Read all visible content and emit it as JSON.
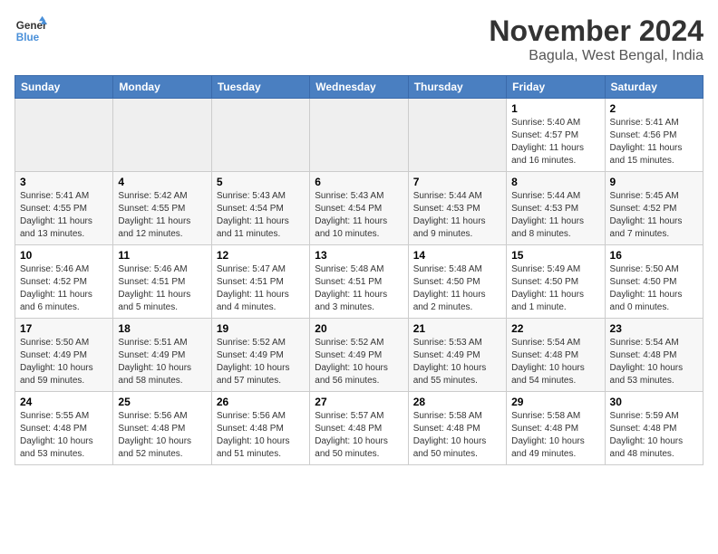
{
  "header": {
    "logo": {
      "line1": "General",
      "line2": "Blue"
    },
    "title": "November 2024",
    "location": "Bagula, West Bengal, India"
  },
  "columns": [
    "Sunday",
    "Monday",
    "Tuesday",
    "Wednesday",
    "Thursday",
    "Friday",
    "Saturday"
  ],
  "weeks": [
    [
      {
        "day": "",
        "info": "",
        "empty": true
      },
      {
        "day": "",
        "info": "",
        "empty": true
      },
      {
        "day": "",
        "info": "",
        "empty": true
      },
      {
        "day": "",
        "info": "",
        "empty": true
      },
      {
        "day": "",
        "info": "",
        "empty": true
      },
      {
        "day": "1",
        "info": "Sunrise: 5:40 AM\nSunset: 4:57 PM\nDaylight: 11 hours and 16 minutes."
      },
      {
        "day": "2",
        "info": "Sunrise: 5:41 AM\nSunset: 4:56 PM\nDaylight: 11 hours and 15 minutes."
      }
    ],
    [
      {
        "day": "3",
        "info": "Sunrise: 5:41 AM\nSunset: 4:55 PM\nDaylight: 11 hours and 13 minutes."
      },
      {
        "day": "4",
        "info": "Sunrise: 5:42 AM\nSunset: 4:55 PM\nDaylight: 11 hours and 12 minutes."
      },
      {
        "day": "5",
        "info": "Sunrise: 5:43 AM\nSunset: 4:54 PM\nDaylight: 11 hours and 11 minutes."
      },
      {
        "day": "6",
        "info": "Sunrise: 5:43 AM\nSunset: 4:54 PM\nDaylight: 11 hours and 10 minutes."
      },
      {
        "day": "7",
        "info": "Sunrise: 5:44 AM\nSunset: 4:53 PM\nDaylight: 11 hours and 9 minutes."
      },
      {
        "day": "8",
        "info": "Sunrise: 5:44 AM\nSunset: 4:53 PM\nDaylight: 11 hours and 8 minutes."
      },
      {
        "day": "9",
        "info": "Sunrise: 5:45 AM\nSunset: 4:52 PM\nDaylight: 11 hours and 7 minutes."
      }
    ],
    [
      {
        "day": "10",
        "info": "Sunrise: 5:46 AM\nSunset: 4:52 PM\nDaylight: 11 hours and 6 minutes."
      },
      {
        "day": "11",
        "info": "Sunrise: 5:46 AM\nSunset: 4:51 PM\nDaylight: 11 hours and 5 minutes."
      },
      {
        "day": "12",
        "info": "Sunrise: 5:47 AM\nSunset: 4:51 PM\nDaylight: 11 hours and 4 minutes."
      },
      {
        "day": "13",
        "info": "Sunrise: 5:48 AM\nSunset: 4:51 PM\nDaylight: 11 hours and 3 minutes."
      },
      {
        "day": "14",
        "info": "Sunrise: 5:48 AM\nSunset: 4:50 PM\nDaylight: 11 hours and 2 minutes."
      },
      {
        "day": "15",
        "info": "Sunrise: 5:49 AM\nSunset: 4:50 PM\nDaylight: 11 hours and 1 minute."
      },
      {
        "day": "16",
        "info": "Sunrise: 5:50 AM\nSunset: 4:50 PM\nDaylight: 11 hours and 0 minutes."
      }
    ],
    [
      {
        "day": "17",
        "info": "Sunrise: 5:50 AM\nSunset: 4:49 PM\nDaylight: 10 hours and 59 minutes."
      },
      {
        "day": "18",
        "info": "Sunrise: 5:51 AM\nSunset: 4:49 PM\nDaylight: 10 hours and 58 minutes."
      },
      {
        "day": "19",
        "info": "Sunrise: 5:52 AM\nSunset: 4:49 PM\nDaylight: 10 hours and 57 minutes."
      },
      {
        "day": "20",
        "info": "Sunrise: 5:52 AM\nSunset: 4:49 PM\nDaylight: 10 hours and 56 minutes."
      },
      {
        "day": "21",
        "info": "Sunrise: 5:53 AM\nSunset: 4:49 PM\nDaylight: 10 hours and 55 minutes."
      },
      {
        "day": "22",
        "info": "Sunrise: 5:54 AM\nSunset: 4:48 PM\nDaylight: 10 hours and 54 minutes."
      },
      {
        "day": "23",
        "info": "Sunrise: 5:54 AM\nSunset: 4:48 PM\nDaylight: 10 hours and 53 minutes."
      }
    ],
    [
      {
        "day": "24",
        "info": "Sunrise: 5:55 AM\nSunset: 4:48 PM\nDaylight: 10 hours and 53 minutes."
      },
      {
        "day": "25",
        "info": "Sunrise: 5:56 AM\nSunset: 4:48 PM\nDaylight: 10 hours and 52 minutes."
      },
      {
        "day": "26",
        "info": "Sunrise: 5:56 AM\nSunset: 4:48 PM\nDaylight: 10 hours and 51 minutes."
      },
      {
        "day": "27",
        "info": "Sunrise: 5:57 AM\nSunset: 4:48 PM\nDaylight: 10 hours and 50 minutes."
      },
      {
        "day": "28",
        "info": "Sunrise: 5:58 AM\nSunset: 4:48 PM\nDaylight: 10 hours and 50 minutes."
      },
      {
        "day": "29",
        "info": "Sunrise: 5:58 AM\nSunset: 4:48 PM\nDaylight: 10 hours and 49 minutes."
      },
      {
        "day": "30",
        "info": "Sunrise: 5:59 AM\nSunset: 4:48 PM\nDaylight: 10 hours and 48 minutes."
      }
    ]
  ]
}
